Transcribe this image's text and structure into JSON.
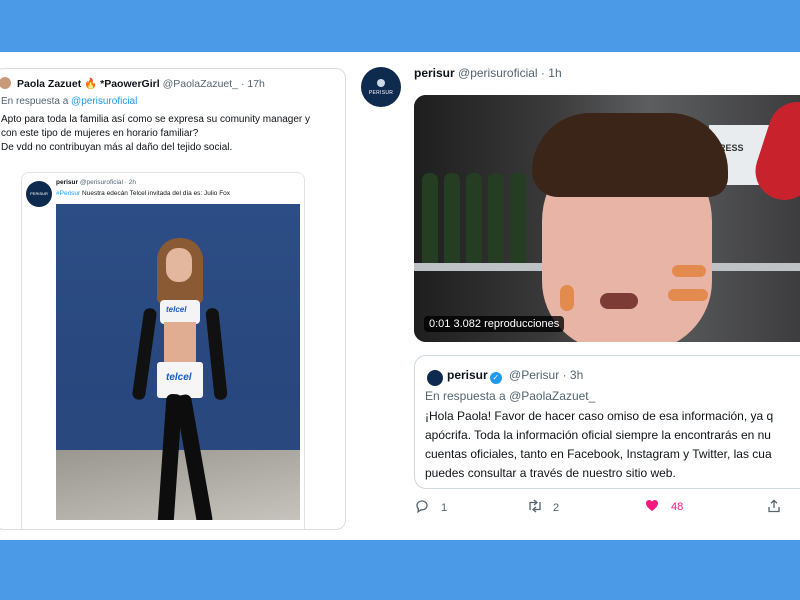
{
  "left_tweet": {
    "name": "Paola Zazuet",
    "badge": "*PaowerGirl",
    "handle": "@PaolaZazuet_",
    "time": "17h",
    "reply_prefix": "En respuesta a",
    "reply_to": "@perisuroficial",
    "text_line1": "Apto para toda la familia así como se expresa su comunity manager y",
    "text_line2": "con este tipo de mujeres en horario familiar?",
    "text_line3": "De vdd no contribuyan más al daño del tejido social.",
    "quoted": {
      "avatar_text": "PERISUR",
      "name": "perisur",
      "handle": "@perisuroficial",
      "time": "2h",
      "hashtag": "#Perisur",
      "text": "Nuestra edecán Telcel invitada del día es: Julio Fox",
      "brand_top": "telcel",
      "brand_skirt": "telcel"
    }
  },
  "right_tweet": {
    "avatar_text": "PERISUR",
    "name": "perisur",
    "handle": "@perisuroficial",
    "time": "1h",
    "video": {
      "time": "0:01",
      "views": "3.082 reproducciones",
      "poster_text": "PRESS"
    },
    "reply": {
      "name": "perisur",
      "handle": "@Perisur",
      "time": "3h",
      "reply_prefix": "En respuesta a",
      "reply_to": "@PaolaZazuet_",
      "line1": "¡Hola Paola! Favor de hacer caso omiso de esa información, ya q",
      "line2": "apócrifa. Toda la información oficial siempre la encontrarás en nu",
      "line3": "cuentas oficiales, tanto en Facebook, Instagram y Twitter, las cua",
      "line4": "puedes consultar a través de nuestro sitio web."
    },
    "actions": {
      "replies": "1",
      "retweets": "2",
      "likes": "48"
    }
  },
  "icons": {
    "reply": "reply-icon",
    "retweet": "retweet-icon",
    "like": "heart-icon",
    "share": "share-icon"
  },
  "colors": {
    "background": "#4a9ae8",
    "link": "#1d9bf0",
    "like": "#f91880",
    "perisur_navy": "#0e2a4f"
  }
}
